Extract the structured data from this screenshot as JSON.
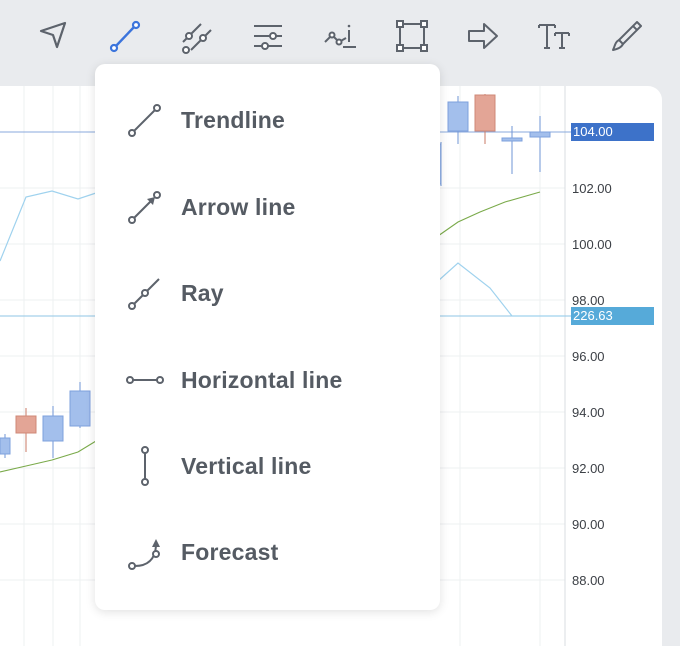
{
  "toolbar": {
    "tools": [
      {
        "name": "cursor-arrow-icon",
        "active": false
      },
      {
        "name": "trendline-icon",
        "active": true
      },
      {
        "name": "parallel-lines-icon",
        "active": false
      },
      {
        "name": "horizontal-lines-icon",
        "active": false
      },
      {
        "name": "annotation-icon",
        "active": false
      },
      {
        "name": "rectangle-icon",
        "active": false
      },
      {
        "name": "arrow-shape-icon",
        "active": false
      },
      {
        "name": "text-icon",
        "active": false
      },
      {
        "name": "brush-icon",
        "active": false
      }
    ],
    "active_color": "#3b74dc",
    "icon_color": "#5d636c"
  },
  "menu": {
    "items": [
      {
        "label": "Trendline",
        "icon": "trendline-icon"
      },
      {
        "label": "Arrow line",
        "icon": "arrow-line-icon"
      },
      {
        "label": "Ray",
        "icon": "ray-icon"
      },
      {
        "label": "Horizontal line",
        "icon": "horizontal-line-icon"
      },
      {
        "label": "Vertical line",
        "icon": "vertical-line-icon"
      },
      {
        "label": "Forecast",
        "icon": "forecast-icon"
      }
    ]
  },
  "price_axis": {
    "labels": [
      "102.00",
      "100.00",
      "98.00",
      "96.00",
      "94.00",
      "92.00",
      "90.00",
      "88.00"
    ],
    "current_price": {
      "value": "104.00",
      "color": "#3d72c9"
    },
    "secondary_value": {
      "value": "226.63",
      "color": "#56aad9"
    }
  },
  "colors": {
    "bull_candle": "#a3bfec",
    "bear_candle": "#e3a596",
    "ma_green": "#7aaa4a",
    "line_light_blue": "#9fd2ee"
  }
}
